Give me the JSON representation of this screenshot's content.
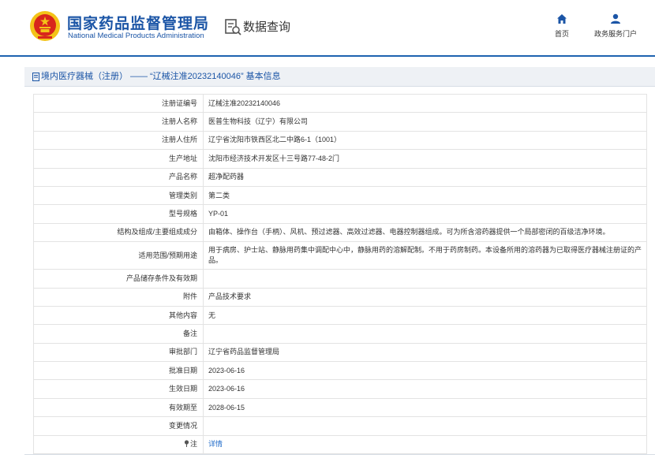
{
  "header": {
    "title_cn": "国家药品监督管理局",
    "title_en": "National Medical Products Administration",
    "query_title": "数据查询",
    "nav": [
      {
        "label": "首页",
        "icon": "home-icon"
      },
      {
        "label": "政务服务门户",
        "icon": "user-icon"
      }
    ]
  },
  "breadcrumb": {
    "category": "境内医疗器械（注册）",
    "separator": "——",
    "record_title": "“辽械注准20232140046” 基本信息"
  },
  "fields": [
    {
      "label": "注册证编号",
      "value": "辽械注准20232140046"
    },
    {
      "label": "注册人名称",
      "value": "医普生物科技（辽宁）有限公司"
    },
    {
      "label": "注册人住所",
      "value": "辽宁省沈阳市铁西区北二中路6-1（1001）"
    },
    {
      "label": "生产地址",
      "value": "沈阳市经济技术开发区十三号路77-48-2门"
    },
    {
      "label": "产品名称",
      "value": "超净配药器"
    },
    {
      "label": "管理类别",
      "value": "第二类"
    },
    {
      "label": "型号规格",
      "value": "YP-01"
    },
    {
      "label": "结构及组成/主要组成成分",
      "value": "由箱体、操作台（手柄）、风机、预过滤器、高效过滤器、电器控制器组成。可为所含溶药器提供一个局部密闭的百级洁净环境。"
    },
    {
      "label": "适用范围/预期用途",
      "value": "用于病房、护士站、静脉用药集中调配中心中，静脉用药的溶解配制。不用于药房制药。本设备所用的溶药器为已取得医疗器械注册证的产品。"
    },
    {
      "label": "产品储存条件及有效期",
      "value": ""
    },
    {
      "label": "附件",
      "value": "产品技术要求"
    },
    {
      "label": "其他内容",
      "value": "无"
    },
    {
      "label": "备注",
      "value": ""
    },
    {
      "label": "审批部门",
      "value": "辽宁省药品监督管理局"
    },
    {
      "label": "批准日期",
      "value": "2023-06-16"
    },
    {
      "label": "生效日期",
      "value": "2023-06-16"
    },
    {
      "label": "有效期至",
      "value": "2028-06-15"
    },
    {
      "label": "变更情况",
      "value": ""
    }
  ],
  "note_row": {
    "label": "注",
    "link": "详情"
  },
  "colors": {
    "brand_blue": "#1b55a6",
    "link_blue": "#1e6ac8",
    "emblem_red": "#d8261c",
    "emblem_gold": "#f3c318"
  }
}
